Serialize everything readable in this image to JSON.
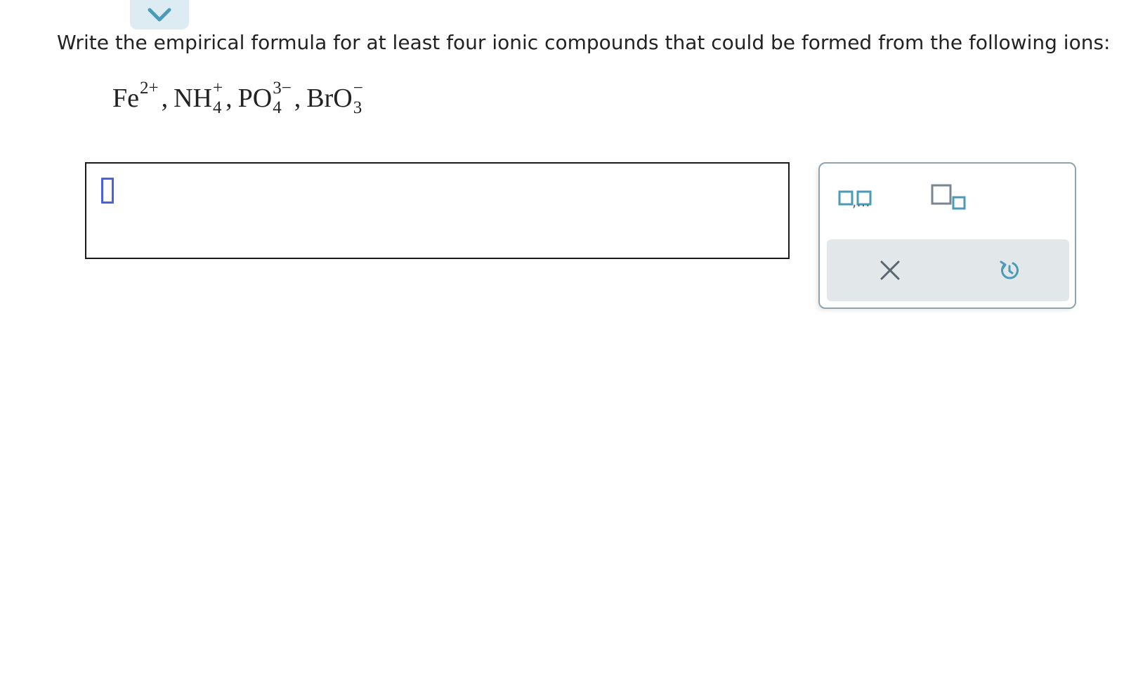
{
  "question": {
    "prompt": "Write the empirical formula for at least four ionic compounds that could be formed from the following ions:",
    "ions": [
      {
        "symbol": "Fe",
        "charge": "2+",
        "subscript": ""
      },
      {
        "symbol": "NH",
        "charge": "+",
        "subscript": "4"
      },
      {
        "symbol": "PO",
        "charge": "3−",
        "subscript": "4"
      },
      {
        "symbol": "BrO",
        "charge": "−",
        "subscript": "3"
      }
    ],
    "separator": ","
  },
  "answer": {
    "value": ""
  },
  "toolbar": {
    "list_button_label": ",...",
    "icons": {
      "collapse": "chevron-down-icon",
      "list": "list-template-icon",
      "subscript": "subscript-template-icon",
      "clear": "close-icon",
      "undo": "undo-icon"
    }
  },
  "colors": {
    "accent": "#4a9ab8",
    "caret": "#4a62e0",
    "tab_bg": "#dcecf2",
    "action_bar_bg": "#e2e7ea",
    "toolbar_border": "#8fa3b0",
    "icon_dark": "#5a6770"
  }
}
